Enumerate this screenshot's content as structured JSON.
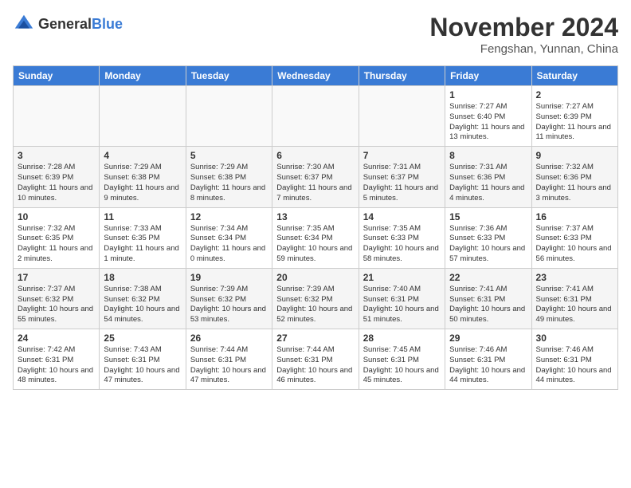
{
  "header": {
    "logo_general": "General",
    "logo_blue": "Blue",
    "title": "November 2024",
    "location": "Fengshan, Yunnan, China"
  },
  "days_of_week": [
    "Sunday",
    "Monday",
    "Tuesday",
    "Wednesday",
    "Thursday",
    "Friday",
    "Saturday"
  ],
  "weeks": [
    [
      {
        "day": "",
        "info": ""
      },
      {
        "day": "",
        "info": ""
      },
      {
        "day": "",
        "info": ""
      },
      {
        "day": "",
        "info": ""
      },
      {
        "day": "",
        "info": ""
      },
      {
        "day": "1",
        "info": "Sunrise: 7:27 AM\nSunset: 6:40 PM\nDaylight: 11 hours and 13 minutes."
      },
      {
        "day": "2",
        "info": "Sunrise: 7:27 AM\nSunset: 6:39 PM\nDaylight: 11 hours and 11 minutes."
      }
    ],
    [
      {
        "day": "3",
        "info": "Sunrise: 7:28 AM\nSunset: 6:39 PM\nDaylight: 11 hours and 10 minutes."
      },
      {
        "day": "4",
        "info": "Sunrise: 7:29 AM\nSunset: 6:38 PM\nDaylight: 11 hours and 9 minutes."
      },
      {
        "day": "5",
        "info": "Sunrise: 7:29 AM\nSunset: 6:38 PM\nDaylight: 11 hours and 8 minutes."
      },
      {
        "day": "6",
        "info": "Sunrise: 7:30 AM\nSunset: 6:37 PM\nDaylight: 11 hours and 7 minutes."
      },
      {
        "day": "7",
        "info": "Sunrise: 7:31 AM\nSunset: 6:37 PM\nDaylight: 11 hours and 5 minutes."
      },
      {
        "day": "8",
        "info": "Sunrise: 7:31 AM\nSunset: 6:36 PM\nDaylight: 11 hours and 4 minutes."
      },
      {
        "day": "9",
        "info": "Sunrise: 7:32 AM\nSunset: 6:36 PM\nDaylight: 11 hours and 3 minutes."
      }
    ],
    [
      {
        "day": "10",
        "info": "Sunrise: 7:32 AM\nSunset: 6:35 PM\nDaylight: 11 hours and 2 minutes."
      },
      {
        "day": "11",
        "info": "Sunrise: 7:33 AM\nSunset: 6:35 PM\nDaylight: 11 hours and 1 minute."
      },
      {
        "day": "12",
        "info": "Sunrise: 7:34 AM\nSunset: 6:34 PM\nDaylight: 11 hours and 0 minutes."
      },
      {
        "day": "13",
        "info": "Sunrise: 7:35 AM\nSunset: 6:34 PM\nDaylight: 10 hours and 59 minutes."
      },
      {
        "day": "14",
        "info": "Sunrise: 7:35 AM\nSunset: 6:33 PM\nDaylight: 10 hours and 58 minutes."
      },
      {
        "day": "15",
        "info": "Sunrise: 7:36 AM\nSunset: 6:33 PM\nDaylight: 10 hours and 57 minutes."
      },
      {
        "day": "16",
        "info": "Sunrise: 7:37 AM\nSunset: 6:33 PM\nDaylight: 10 hours and 56 minutes."
      }
    ],
    [
      {
        "day": "17",
        "info": "Sunrise: 7:37 AM\nSunset: 6:32 PM\nDaylight: 10 hours and 55 minutes."
      },
      {
        "day": "18",
        "info": "Sunrise: 7:38 AM\nSunset: 6:32 PM\nDaylight: 10 hours and 54 minutes."
      },
      {
        "day": "19",
        "info": "Sunrise: 7:39 AM\nSunset: 6:32 PM\nDaylight: 10 hours and 53 minutes."
      },
      {
        "day": "20",
        "info": "Sunrise: 7:39 AM\nSunset: 6:32 PM\nDaylight: 10 hours and 52 minutes."
      },
      {
        "day": "21",
        "info": "Sunrise: 7:40 AM\nSunset: 6:31 PM\nDaylight: 10 hours and 51 minutes."
      },
      {
        "day": "22",
        "info": "Sunrise: 7:41 AM\nSunset: 6:31 PM\nDaylight: 10 hours and 50 minutes."
      },
      {
        "day": "23",
        "info": "Sunrise: 7:41 AM\nSunset: 6:31 PM\nDaylight: 10 hours and 49 minutes."
      }
    ],
    [
      {
        "day": "24",
        "info": "Sunrise: 7:42 AM\nSunset: 6:31 PM\nDaylight: 10 hours and 48 minutes."
      },
      {
        "day": "25",
        "info": "Sunrise: 7:43 AM\nSunset: 6:31 PM\nDaylight: 10 hours and 47 minutes."
      },
      {
        "day": "26",
        "info": "Sunrise: 7:44 AM\nSunset: 6:31 PM\nDaylight: 10 hours and 47 minutes."
      },
      {
        "day": "27",
        "info": "Sunrise: 7:44 AM\nSunset: 6:31 PM\nDaylight: 10 hours and 46 minutes."
      },
      {
        "day": "28",
        "info": "Sunrise: 7:45 AM\nSunset: 6:31 PM\nDaylight: 10 hours and 45 minutes."
      },
      {
        "day": "29",
        "info": "Sunrise: 7:46 AM\nSunset: 6:31 PM\nDaylight: 10 hours and 44 minutes."
      },
      {
        "day": "30",
        "info": "Sunrise: 7:46 AM\nSunset: 6:31 PM\nDaylight: 10 hours and 44 minutes."
      }
    ]
  ]
}
